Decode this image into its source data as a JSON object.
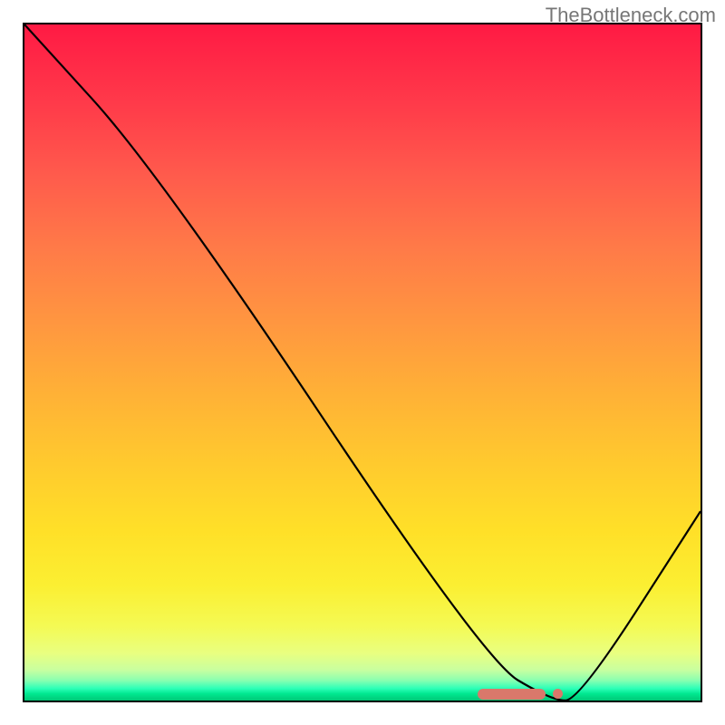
{
  "watermark": "TheBottleneck.com",
  "chart_data": {
    "type": "line",
    "title": "",
    "xlabel": "",
    "ylabel": "",
    "xlim": [
      0,
      100
    ],
    "ylim": [
      0,
      100
    ],
    "grid": false,
    "legend": false,
    "background": "red-yellow-green vertical gradient",
    "series": [
      {
        "name": "bottleneck-curve",
        "x": [
          0,
          20,
          68,
          78,
          82,
          100
        ],
        "values": [
          100,
          78,
          6,
          0,
          0,
          28
        ]
      }
    ],
    "marker": {
      "name": "optimal-range",
      "x_start": 67,
      "x_end": 79,
      "y": 1
    }
  }
}
